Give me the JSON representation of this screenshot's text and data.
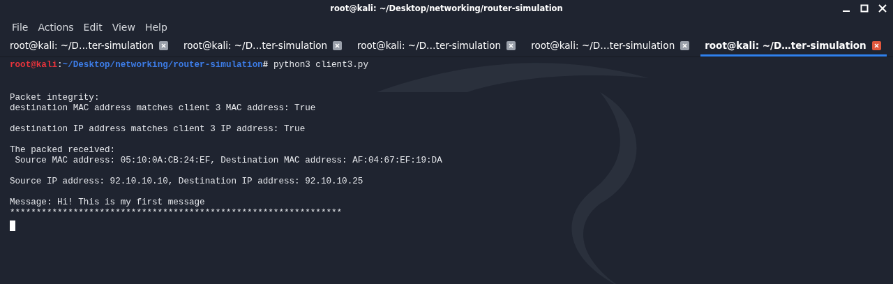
{
  "window": {
    "title": "root@kali: ~/Desktop/networking/router-simulation"
  },
  "menu": [
    "File",
    "Actions",
    "Edit",
    "View",
    "Help"
  ],
  "tabs": [
    {
      "label": "root@kali: ~/D…ter-simulation",
      "selected": false
    },
    {
      "label": "root@kali: ~/D…ter-simulation",
      "selected": false
    },
    {
      "label": "root@kali: ~/D…ter-simulation",
      "selected": false
    },
    {
      "label": "root@kali: ~/D…ter-simulation",
      "selected": false
    },
    {
      "label": "root@kali: ~/D…ter-simulation",
      "selected": true
    }
  ],
  "terminal": {
    "lines": [
      {
        "kind": "prompt",
        "segments": [
          {
            "text": "root@kali",
            "color": "#e8343c"
          },
          {
            "text": ":",
            "color": "#d0d4da"
          },
          {
            "text": "~/Desktop/networking/router-simulation",
            "color": "#3d7de8"
          },
          {
            "text": "#",
            "color": "#ffffff"
          }
        ],
        "command": "python3 client3.py"
      },
      {
        "kind": "blank"
      },
      {
        "kind": "output",
        "text": "Packet integrity:"
      },
      {
        "kind": "output",
        "text": "destination MAC address matches client 3 MAC address: True"
      },
      {
        "kind": "blank"
      },
      {
        "kind": "output",
        "text": "destination IP address matches client 3 IP address: True"
      },
      {
        "kind": "blank"
      },
      {
        "kind": "output",
        "text": "The packed received:"
      },
      {
        "kind": "output",
        "text": " Source MAC address: 05:10:0A:CB:24:EF, Destination MAC address: AF:04:67:EF:19:DA"
      },
      {
        "kind": "blank"
      },
      {
        "kind": "output",
        "text": "Source IP address: 92.10.10.10, Destination IP address: 92.10.10.25"
      },
      {
        "kind": "blank"
      },
      {
        "kind": "output",
        "text": "Message: Hi! This is my first message"
      },
      {
        "kind": "output",
        "text": "***************************************************************"
      },
      {
        "kind": "cursor"
      }
    ]
  }
}
